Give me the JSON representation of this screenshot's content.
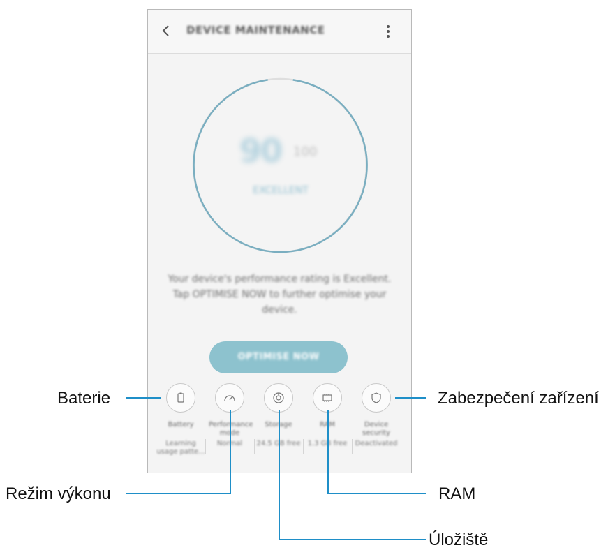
{
  "app": {
    "title": "DEVICE MAINTENANCE"
  },
  "score": {
    "value": "90",
    "max": "100",
    "label": "EXCELLENT"
  },
  "description": "Your device's performance rating is Excellent. Tap OPTIMISE NOW to further optimise your device.",
  "optimise_button": "OPTIMISE NOW",
  "features": [
    {
      "name": "Battery",
      "value": "Learning usage patte..."
    },
    {
      "name": "Performance mode",
      "value": "Normal"
    },
    {
      "name": "Storage",
      "value": "24.5 GB free"
    },
    {
      "name": "RAM",
      "value": "1.3 GB free"
    },
    {
      "name": "Device security",
      "value": "Deactivated"
    }
  ],
  "callouts": {
    "battery": "Baterie",
    "performance": "Režim výkonu",
    "storage": "Úložiště",
    "ram": "RAM",
    "security": "Zabezpečení zařízení"
  },
  "colors": {
    "accent": "#8dc2ce",
    "ring": "#7aaec0",
    "callout_line": "#1f8fc8"
  }
}
